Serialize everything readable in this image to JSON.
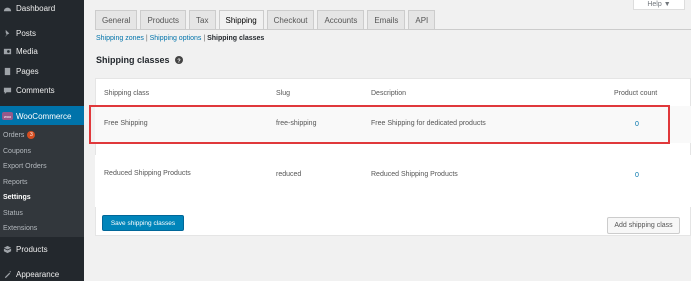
{
  "sidebar": {
    "items": [
      {
        "label": "Dashboard",
        "icon": "dashboard-icon"
      },
      {
        "label": "Posts",
        "icon": "pin-icon"
      },
      {
        "label": "Media",
        "icon": "media-icon"
      },
      {
        "label": "Pages",
        "icon": "pages-icon"
      },
      {
        "label": "Comments",
        "icon": "comments-icon"
      },
      {
        "label": "WooCommerce",
        "icon": "woocommerce-icon"
      },
      {
        "label": "Products",
        "icon": "products-icon"
      },
      {
        "label": "Appearance",
        "icon": "appearance-icon"
      }
    ],
    "submenu": [
      {
        "label": "Orders",
        "badge": "3"
      },
      {
        "label": "Coupons"
      },
      {
        "label": "Export Orders"
      },
      {
        "label": "Reports"
      },
      {
        "label": "Settings"
      },
      {
        "label": "Status"
      },
      {
        "label": "Extensions"
      }
    ]
  },
  "help": {
    "label": "Help ▼"
  },
  "tabs": [
    "General",
    "Products",
    "Tax",
    "Shipping",
    "Checkout",
    "Accounts",
    "Emails",
    "API"
  ],
  "subsub": {
    "zones": "Shipping zones",
    "options": "Shipping options",
    "classes": "Shipping classes",
    "sep": "|"
  },
  "section_title": "Shipping classes",
  "table": {
    "headers": [
      "Shipping class",
      "Slug",
      "Description",
      "Product count"
    ],
    "rows": [
      {
        "name": "Free Shipping",
        "slug": "free-shipping",
        "description": "Free Shipping for dedicated products",
        "count": "0"
      },
      {
        "name": "Reduced Shipping Products",
        "slug": "reduced",
        "description": "Reduced Shipping Products",
        "count": "0"
      }
    ]
  },
  "buttons": {
    "save": "Save shipping classes",
    "add": "Add shipping class"
  },
  "colors": {
    "sidebar": "#23282d",
    "accent": "#0073aa",
    "highlight": "#e0383b",
    "woo": "#96588a"
  }
}
